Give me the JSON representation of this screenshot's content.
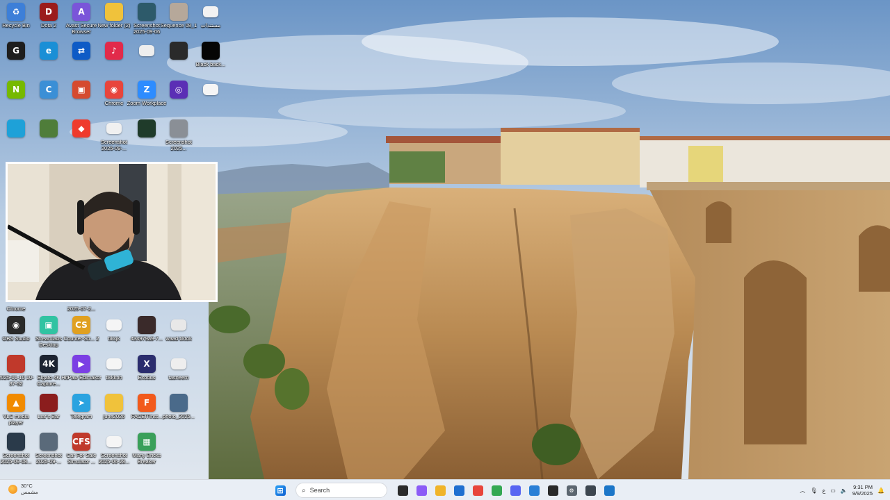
{
  "desktop": {
    "icons": [
      {
        "label": "Recycle Bin",
        "icon": "recycle-bin-icon",
        "color": "#3d7fd8",
        "glyph": "♻"
      },
      {
        "label": "Dota 2",
        "icon": "dota2-icon",
        "color": "#9b1c1c",
        "glyph": "D"
      },
      {
        "label": "Avast Secure Browser",
        "icon": "avast-browser-icon",
        "color": "#7a55d9",
        "glyph": "A"
      },
      {
        "label": "New folder (2)",
        "icon": "folder-icon",
        "color": "#f0c23b",
        "glyph": ""
      },
      {
        "label": "Screenshot 2025-09-06",
        "icon": "screenshot-icon",
        "color": "#2d5a6a",
        "glyph": ""
      },
      {
        "label": "Sequence 08_1",
        "icon": "video-file-icon",
        "color": "#b6a89a",
        "glyph": ""
      },
      {
        "label": "مستندات",
        "icon": "document-icon",
        "color": "#f2f2f2",
        "glyph": ""
      },
      {
        "label": "",
        "icon": "gaming-app-icon",
        "color": "#1e1e1e",
        "glyph": "G"
      },
      {
        "label": "",
        "icon": "edge-browser-icon",
        "color": "#1a8fd6",
        "glyph": "e"
      },
      {
        "label": "",
        "icon": "teamviewer-icon",
        "color": "#0e5bc6",
        "glyph": "⇄"
      },
      {
        "label": "",
        "icon": "tiktok-icon",
        "color": "#e22a4a",
        "glyph": "♪"
      },
      {
        "label": "",
        "icon": "blank-file-icon",
        "color": "#eeeeee",
        "glyph": ""
      },
      {
        "label": "",
        "icon": "app-thumbnail-icon",
        "color": "#2a2a2a",
        "glyph": ""
      },
      {
        "label": "Black back...",
        "icon": "image-file-icon",
        "color": "#050505",
        "glyph": ""
      },
      {
        "label": "",
        "icon": "nvidia-icon",
        "color": "#76b900",
        "glyph": "N"
      },
      {
        "label": "",
        "icon": "chrome-profile-icon",
        "color": "#3b8fd6",
        "glyph": "C"
      },
      {
        "label": "",
        "icon": "installer-icon",
        "color": "#d54a2f",
        "glyph": "▣"
      },
      {
        "label": "Chrome",
        "icon": "chrome-icon",
        "color": "#e8453c",
        "glyph": "◉"
      },
      {
        "label": "Zoom Workplace",
        "icon": "zoom-icon",
        "color": "#2d8cff",
        "glyph": "Z"
      },
      {
        "label": "",
        "icon": "obs-like-icon",
        "color": "#5b2fb5",
        "glyph": "◎"
      },
      {
        "label": "",
        "icon": "text-file-icon",
        "color": "#f5f5f5",
        "glyph": ""
      },
      {
        "label": "",
        "icon": "monitor-icon",
        "color": "#1ea1d8",
        "glyph": ""
      },
      {
        "label": "",
        "icon": "game-icon",
        "color": "#4f7d3a",
        "glyph": ""
      },
      {
        "label": "",
        "icon": "anydesk-icon",
        "color": "#ef3b2d",
        "glyph": "◆"
      },
      {
        "label": "Screenshot 2025-09-...",
        "icon": "screenshot-icon",
        "color": "#f0f0f0",
        "glyph": ""
      },
      {
        "label": "",
        "icon": "phone-image-icon",
        "color": "#1f3b2a",
        "glyph": ""
      },
      {
        "label": "Screenshot 2025...",
        "icon": "screenshot-icon",
        "color": "#8a8f96",
        "glyph": ""
      }
    ],
    "lower_icons": [
      {
        "label": "Chrome",
        "icon": "chrome-icon",
        "color": "#e8453c",
        "glyph": ""
      },
      {
        "label": "2025-07-2...",
        "icon": "video-file-icon",
        "color": "#444",
        "glyph": ""
      },
      {
        "label": "OBS Studio",
        "icon": "obs-studio-icon",
        "color": "#2a2a2a",
        "glyph": "◉"
      },
      {
        "label": "Streamlabs Desktop",
        "icon": "streamlabs-icon",
        "color": "#31c3a2",
        "glyph": "▣"
      },
      {
        "label": "Counter-Str... 2",
        "icon": "counter-strike-icon",
        "color": "#e0a020",
        "glyph": "CS"
      },
      {
        "label": "tikkjk",
        "icon": "text-file-icon",
        "color": "#f5f5f5",
        "glyph": ""
      },
      {
        "label": "434979a9-7...",
        "icon": "phone-image-icon",
        "color": "#3a2a2a",
        "glyph": ""
      },
      {
        "label": "waad tiktok",
        "icon": "phone-image-icon",
        "color": "#e8e8e8",
        "glyph": ""
      },
      {
        "label": "2025-01-10 10-37-52",
        "icon": "video-file-icon",
        "color": "#c0392b",
        "glyph": ""
      },
      {
        "label": "Elgato 4K Capture...",
        "icon": "elgato-icon",
        "color": "#1c2331",
        "glyph": "4K"
      },
      {
        "label": "HitPaw Edimakor",
        "icon": "hitpaw-icon",
        "color": "#7b3fe4",
        "glyph": "▶"
      },
      {
        "label": "tikkknh",
        "icon": "text-file-icon",
        "color": "#f5f5f5",
        "glyph": ""
      },
      {
        "label": "Exodus",
        "icon": "exodus-icon",
        "color": "#2b2d6e",
        "glyph": "X"
      },
      {
        "label": "tasneem",
        "icon": "phone-image-icon",
        "color": "#eeeeee",
        "glyph": ""
      },
      {
        "label": "VLC media player",
        "icon": "vlc-icon",
        "color": "#f18b00",
        "glyph": "▲"
      },
      {
        "label": "Liar's Bar",
        "icon": "liars-bar-icon",
        "color": "#8b1d1d",
        "glyph": ""
      },
      {
        "label": "Telegram",
        "icon": "telegram-icon",
        "color": "#2aa3e0",
        "glyph": "➤"
      },
      {
        "label": "june2026",
        "icon": "folder-icon",
        "color": "#f0c23b",
        "glyph": ""
      },
      {
        "label": "FACEITInst...",
        "icon": "faceit-icon",
        "color": "#f25a1c",
        "glyph": "F"
      },
      {
        "label": "photo_2025...",
        "icon": "image-file-icon",
        "color": "#4a6a8a",
        "glyph": ""
      },
      {
        "label": "Screenshot 2025-09-08...",
        "icon": "screenshot-icon",
        "color": "#2a3a4a",
        "glyph": ""
      },
      {
        "label": "Screenshot 2025-09-...",
        "icon": "screenshot-icon",
        "color": "#5a6a7a",
        "glyph": ""
      },
      {
        "label": "Car For Sale Simulator ...",
        "icon": "car-sale-icon",
        "color": "#c0392b",
        "glyph": "CFS"
      },
      {
        "label": "Screenshot 2025-06-28...",
        "icon": "screenshot-icon",
        "color": "#f5f5f5",
        "glyph": ""
      },
      {
        "label": "Many Bricks Breaker",
        "icon": "bricks-game-icon",
        "color": "#3aa05a",
        "glyph": "▦"
      }
    ]
  },
  "taskbar": {
    "weather": {
      "temp": "30°C",
      "condition": "مشمس"
    },
    "search_placeholder": "Search",
    "apps": [
      {
        "name": "start-button",
        "color": "#1a7fe0",
        "glyph": "⊞"
      },
      {
        "name": "task-view-icon",
        "color": "#2b2b2b",
        "glyph": ""
      },
      {
        "name": "copilot-icon",
        "color": "#8b5cf6",
        "glyph": ""
      },
      {
        "name": "file-explorer-icon",
        "color": "#f0b429",
        "glyph": ""
      },
      {
        "name": "store-icon",
        "color": "#1f6fd0",
        "glyph": ""
      },
      {
        "name": "chrome-taskbar-icon",
        "color": "#e8453c",
        "glyph": ""
      },
      {
        "name": "chrome-active-icon",
        "color": "#34a853",
        "glyph": ""
      },
      {
        "name": "discord-icon",
        "color": "#5865f2",
        "glyph": ""
      },
      {
        "name": "window-icon",
        "color": "#2a7fd6",
        "glyph": ""
      },
      {
        "name": "obs-taskbar-icon",
        "color": "#2a2a2a",
        "glyph": ""
      },
      {
        "name": "settings-icon",
        "color": "#5c6670",
        "glyph": "⚙"
      },
      {
        "name": "calculator-icon",
        "color": "#3d4650",
        "glyph": ""
      },
      {
        "name": "remote-desktop-icon",
        "color": "#1c76c8",
        "glyph": ""
      }
    ],
    "tray": {
      "lang": "ع",
      "time": "9:31 PM",
      "date": "9/9/2025"
    }
  }
}
